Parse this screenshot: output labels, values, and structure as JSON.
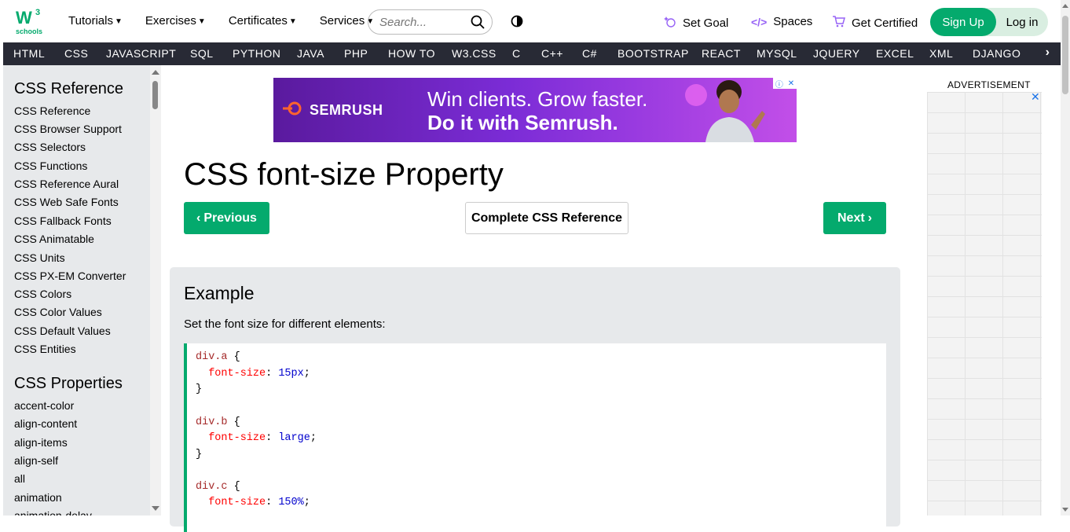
{
  "header": {
    "logo_text": "schools",
    "logo_sup": "3",
    "menu": [
      {
        "label": "Tutorials"
      },
      {
        "label": "Exercises"
      },
      {
        "label": "Certificates"
      },
      {
        "label": "Services"
      }
    ],
    "search_placeholder": "Search...",
    "set_goal": "Set Goal",
    "spaces": "Spaces",
    "get_certified": "Get Certified",
    "sign_up": "Sign Up",
    "log_in": "Log in"
  },
  "topnav": {
    "items": [
      "HTML",
      "CSS",
      "JAVASCRIPT",
      "SQL",
      "PYTHON",
      "JAVA",
      "PHP",
      "HOW TO",
      "W3.CSS",
      "C",
      "C++",
      "C#",
      "BOOTSTRAP",
      "REACT",
      "MYSQL",
      "JQUERY",
      "EXCEL",
      "XML",
      "DJANGO"
    ]
  },
  "sidebar": {
    "heading1": "CSS Reference",
    "items1": [
      "CSS Reference",
      "CSS Browser Support",
      "CSS Selectors",
      "CSS Functions",
      "CSS Reference Aural",
      "CSS Web Safe Fonts",
      "CSS Fallback Fonts",
      "CSS Animatable",
      "CSS Units",
      "CSS PX-EM Converter",
      "CSS Colors",
      "CSS Color Values",
      "CSS Default Values",
      "CSS Entities"
    ],
    "heading2": "CSS Properties",
    "items2": [
      "accent-color",
      "align-content",
      "align-items",
      "align-self",
      "all",
      "animation",
      "animation-delay"
    ]
  },
  "ad": {
    "brand": "SEMRUSH",
    "line1": "Win clients. Grow faster.",
    "line2": "Do it with Semrush."
  },
  "main": {
    "title": "CSS font-size Property",
    "prev_label": "Previous",
    "ref_label": "Complete CSS Reference",
    "next_label": "Next"
  },
  "example": {
    "heading": "Example",
    "description": "Set the font size for different elements:",
    "code": [
      {
        "selector": "div.a",
        "property": "font-size",
        "value": "15px"
      },
      {
        "selector": "div.b",
        "property": "font-size",
        "value": "large"
      },
      {
        "selector": "div.c",
        "property": "font-size",
        "value": "150%"
      }
    ]
  },
  "right": {
    "ad_label": "ADVERTISEMENT"
  },
  "colors": {
    "accent": "#04aa6d",
    "nav_dark": "#282a35",
    "sidebar_bg": "#e7e9eb"
  }
}
